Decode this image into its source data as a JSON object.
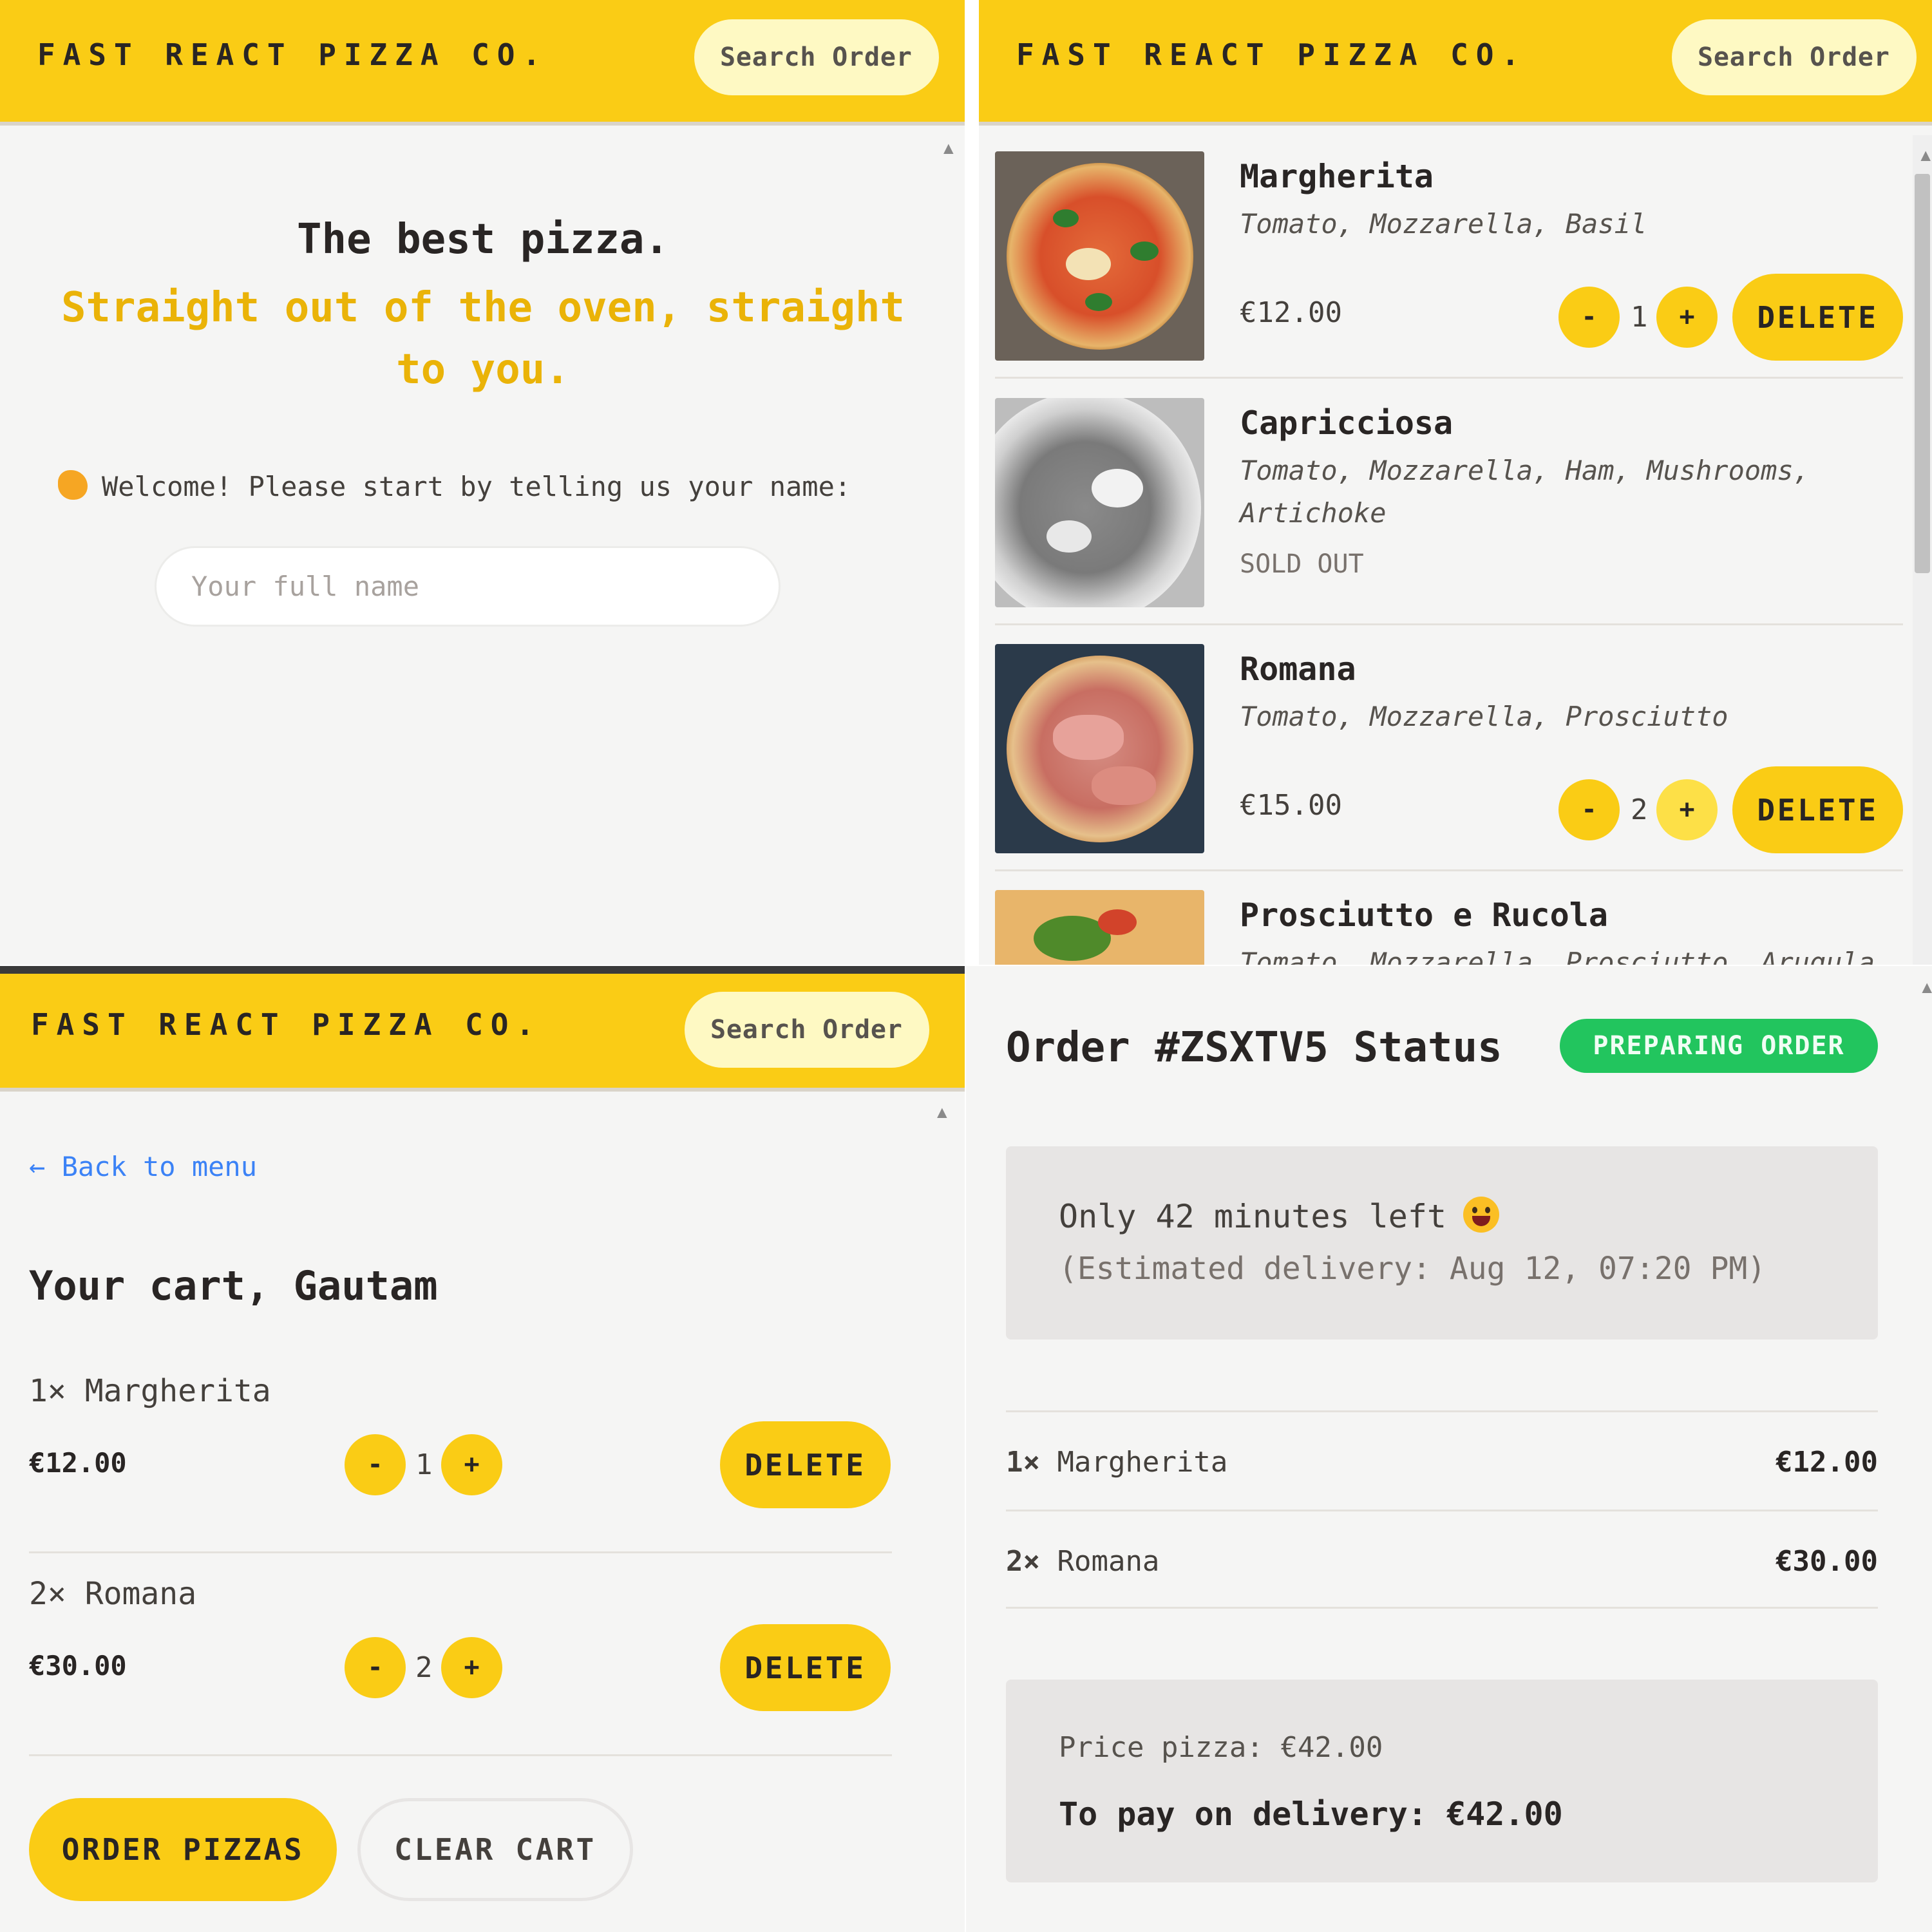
{
  "brand": "FAST REACT PIZZA CO.",
  "search_placeholder": "Search Order",
  "colors": {
    "brand_yellow": "#facc15",
    "search_bg": "#fef9c3",
    "page_bg": "#f5f5f4",
    "status_green": "#22c55e",
    "link_blue": "#3b82f6"
  },
  "home": {
    "headline": "The best pizza.",
    "subheadline": "Straight out of the oven, straight to you.",
    "welcome_icon": "waving-hand-icon",
    "welcome_text": "Welcome! Please start by telling us your name:",
    "name_placeholder": "Your full name"
  },
  "menu": {
    "items": [
      {
        "name": "Margherita",
        "ingredients": "Tomato, Mozzarella, Basil",
        "price": "€12.00",
        "quantity": "1",
        "decrease_label": "-",
        "increase_label": "+",
        "delete_label": "DELETE"
      },
      {
        "name": "Capricciosa",
        "ingredients": "Tomato, Mozzarella, Ham, Mushrooms, Artichoke",
        "status": "SOLD OUT"
      },
      {
        "name": "Romana",
        "ingredients": "Tomato, Mozzarella, Prosciutto",
        "price": "€15.00",
        "quantity": "2",
        "decrease_label": "-",
        "increase_label": "+",
        "delete_label": "DELETE"
      },
      {
        "name": "Prosciutto e Rucola",
        "ingredients": "Tomato, Mozzarella, Prosciutto, Arugula"
      }
    ]
  },
  "cart": {
    "back_link": "← Back to menu",
    "title": "Your cart, Gautam",
    "items": [
      {
        "name": "1× Margherita",
        "price": "€12.00",
        "quantity": "1",
        "decrease_label": "-",
        "increase_label": "+",
        "delete_label": "DELETE"
      },
      {
        "name": "2× Romana",
        "price": "€30.00",
        "quantity": "2",
        "decrease_label": "-",
        "increase_label": "+",
        "delete_label": "DELETE"
      }
    ],
    "order_button": "ORDER PIZZAS",
    "clear_button": "CLEAR CART"
  },
  "order": {
    "title": "Order #ZSXTV5 Status",
    "status_badge": "PREPARING ORDER",
    "time_left": "Only 42 minutes left",
    "time_left_icon": "grinning-face-icon",
    "estimated": "(Estimated delivery: Aug 12, 07:20 PM)",
    "lines": [
      {
        "qty": "1×",
        "name": "Margherita",
        "price": "€12.00"
      },
      {
        "qty": "2×",
        "name": "Romana",
        "price": "€30.00"
      }
    ],
    "price_pizza": "Price pizza: €42.00",
    "to_pay": "To pay on delivery: €42.00"
  }
}
